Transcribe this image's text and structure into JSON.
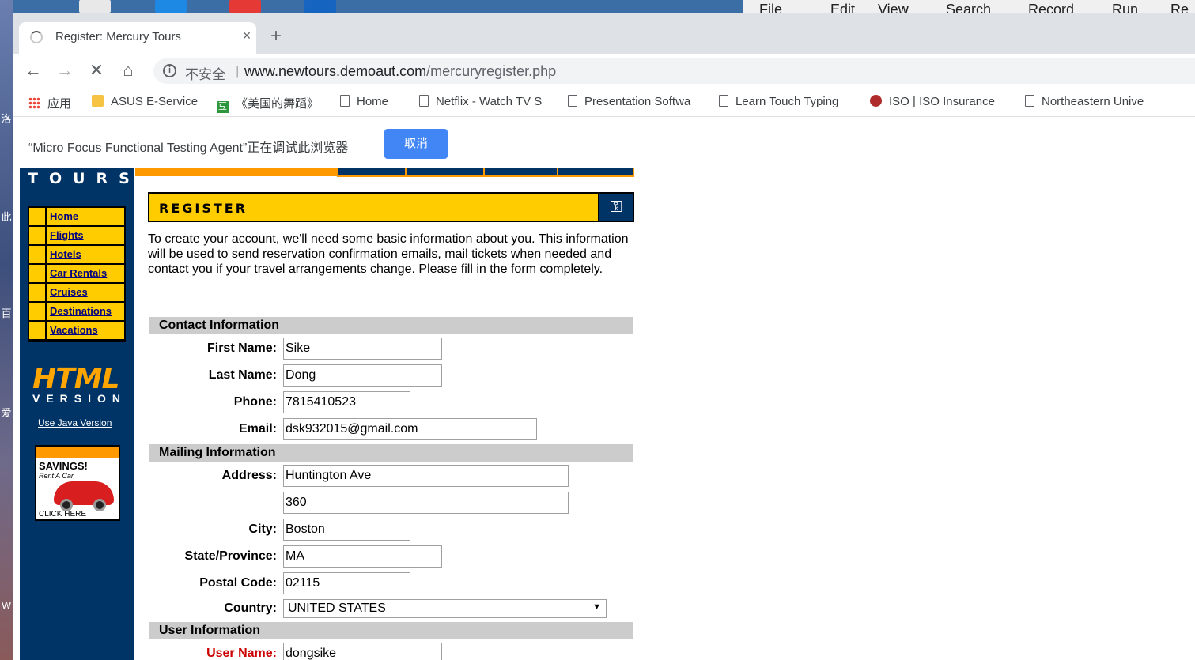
{
  "browser": {
    "tab_title": "Register: Mercury Tours",
    "tab_close": "×",
    "new_tab": "+",
    "security_label": "不安全",
    "url_host": "www.newtours.demoaut.com",
    "url_path": "/mercuryregister.php",
    "bookmarks": [
      {
        "label": "应用",
        "icon": "apps-grid-icon"
      },
      {
        "label": "ASUS E-Service",
        "icon": "folder-icon"
      },
      {
        "label": "《美国的舞蹈》",
        "icon": "douban-icon"
      },
      {
        "label": "Home",
        "icon": "page-icon"
      },
      {
        "label": "Netflix - Watch TV S",
        "icon": "page-icon"
      },
      {
        "label": "Presentation Softwa",
        "icon": "page-icon"
      },
      {
        "label": "Learn Touch Typing",
        "icon": "page-icon"
      },
      {
        "label": "ISO | ISO Insurance",
        "icon": "iso-icon"
      },
      {
        "label": "Northeastern Unive",
        "icon": "page-icon"
      }
    ],
    "infobar": {
      "message": "“Micro Focus Functional Testing Agent”正在调试此浏览器",
      "cancel_label": "取消"
    }
  },
  "desktop": {
    "app_menu": [
      "File",
      "Edit",
      "View",
      "Search",
      "Record",
      "Run",
      "Re"
    ]
  },
  "site": {
    "logo_sub": "TOURS",
    "nav": [
      "Home",
      "Flights",
      "Hotels",
      "Car Rentals",
      "Cruises",
      "Destinations",
      "Vacations"
    ],
    "html_logo": "HTML",
    "html_version": "VERSION",
    "java_link": "Use Java Version",
    "ad": {
      "headline": "SAVINGS!",
      "sub": "Rent A Car",
      "cta": "CLICK HERE"
    }
  },
  "register": {
    "banner": "REGISTER",
    "intro": "To create your account, we'll need some basic information about you. This information will be used to send reservation confirmation emails, mail tickets when needed and contact you if your travel arrangements change. Please fill in the form completely.",
    "sections": {
      "contact": "Contact Information",
      "mailing": "Mailing Information",
      "user": "User Information"
    },
    "fields": {
      "first_name": {
        "label": "First Name:",
        "value": "Sike"
      },
      "last_name": {
        "label": "Last Name:",
        "value": "Dong"
      },
      "phone": {
        "label": "Phone:",
        "value": "7815410523"
      },
      "email": {
        "label": "Email:",
        "value": "dsk932015@gmail.com"
      },
      "address1": {
        "label": "Address:",
        "value": "Huntington Ave"
      },
      "address2": {
        "value": "360"
      },
      "city": {
        "label": "City:",
        "value": "Boston"
      },
      "state": {
        "label": "State/Province:",
        "value": "MA"
      },
      "postal": {
        "label": "Postal Code:",
        "value": "02115"
      },
      "country": {
        "label": "Country:",
        "value": "UNITED STATES"
      },
      "username": {
        "label": "User Name:",
        "value": "dongsike"
      }
    }
  },
  "colors": {
    "nav_bg": "#003366",
    "accent_yellow": "#ffcc00",
    "accent_orange": "#ff9900",
    "infobar_button": "#4285f4"
  }
}
